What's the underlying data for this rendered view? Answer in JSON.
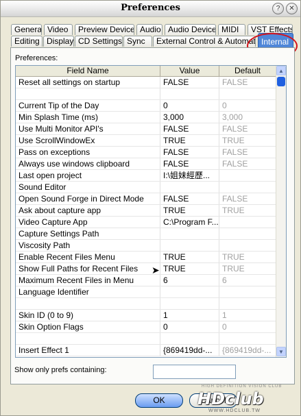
{
  "window": {
    "title": "Preferences"
  },
  "tabs_row1": [
    "General",
    "Video",
    "Preview Device",
    "Audio",
    "Audio Device",
    "MIDI",
    "VST Effects"
  ],
  "tabs_row2": [
    "Editing",
    "Display",
    "CD Settings",
    "Sync",
    "External Control & Automation",
    "Internal"
  ],
  "active_tab": "Internal",
  "panel_label": "Preferences:",
  "grid": {
    "headers": [
      "Field Name",
      "Value",
      "Default"
    ],
    "rows": [
      [
        "Reset all settings on startup",
        "FALSE",
        "FALSE"
      ],
      [
        "",
        "",
        ""
      ],
      [
        "Current Tip of the Day",
        "0",
        "0"
      ],
      [
        "Min Splash Time (ms)",
        "3,000",
        "3,000"
      ],
      [
        "Use Multi Monitor API's",
        "FALSE",
        "FALSE"
      ],
      [
        "Use ScrollWindowEx",
        "TRUE",
        "TRUE"
      ],
      [
        "Pass on exceptions",
        "FALSE",
        "FALSE"
      ],
      [
        "Always use windows clipboard",
        "FALSE",
        "FALSE"
      ],
      [
        "Last open project",
        "I:\\姐妹經歷...",
        ""
      ],
      [
        "Sound Editor",
        "",
        ""
      ],
      [
        "Open Sound Forge in Direct Mode",
        "FALSE",
        "FALSE"
      ],
      [
        "Ask about capture app",
        "TRUE",
        "TRUE"
      ],
      [
        "Video Capture App",
        "C:\\Program F...",
        ""
      ],
      [
        "Capture Settings Path",
        "",
        ""
      ],
      [
        "Viscosity Path",
        "",
        ""
      ],
      [
        "Enable Recent Files Menu",
        "TRUE",
        "TRUE"
      ],
      [
        "Show Full Paths for Recent Files",
        "TRUE",
        "TRUE"
      ],
      [
        "Maximum Recent Files in Menu",
        "6",
        "6"
      ],
      [
        "Language Identifier",
        "",
        ""
      ],
      [
        "",
        "",
        ""
      ],
      [
        "Skin ID (0 to 9)",
        "1",
        "1"
      ],
      [
        "Skin Option Flags",
        "0",
        "0"
      ],
      [
        "",
        "",
        ""
      ],
      [
        "Insert Effect 1",
        "{869419dd-...",
        "{869419dd-..."
      ]
    ]
  },
  "filter": {
    "label": "Show only prefs containing:",
    "value": ""
  },
  "buttons": {
    "ok": "OK",
    "cancel": "Cancel"
  },
  "watermark": {
    "top": "HIGH DEFINITION VISION CLUB",
    "logo": "HDclub",
    "url": "WWW.HDCLUB.TW"
  },
  "colors": {
    "active_tab": "#4f86d8",
    "highlight_circle": "#d4121a",
    "default_text": "#a0a0a0"
  }
}
